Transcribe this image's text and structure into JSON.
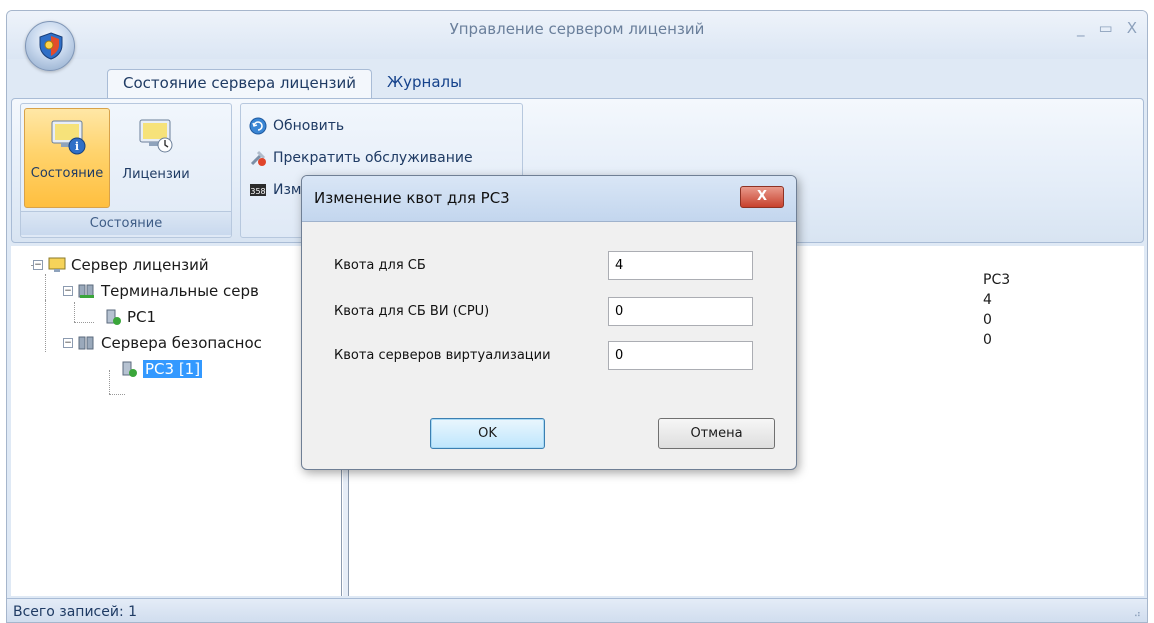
{
  "window": {
    "title": "Управление сервером лицензий",
    "controls": {
      "minimize": "_",
      "maximize": "▭",
      "close": "X"
    }
  },
  "tabs": [
    {
      "label": "Состояние сервера лицензий",
      "active": true
    },
    {
      "label": "Журналы",
      "active": false
    }
  ],
  "ribbon": {
    "group_state": {
      "label": "Состояние",
      "buttons": [
        {
          "label": "Состояние",
          "icon": "monitor-info-icon",
          "active": true
        },
        {
          "label": "Лицензии",
          "icon": "monitor-clock-icon",
          "active": false
        }
      ]
    },
    "group_actions": {
      "items": [
        {
          "label": "Обновить",
          "icon": "refresh-icon"
        },
        {
          "label": "Прекратить обслуживание",
          "icon": "stop-service-icon"
        },
        {
          "label": "Изм",
          "icon": "quota-icon"
        }
      ]
    }
  },
  "tree": {
    "root": "Сервер лицензий",
    "terminal_servers": "Терминальные серв",
    "pc1": "PC1",
    "security_servers": "Сервера безопаснос",
    "pc3": "PC3 [1]"
  },
  "details": {
    "values": [
      "PC3",
      "4",
      "0",
      "0"
    ]
  },
  "status": {
    "total": "Всего записей: 1",
    "grip": "⠴"
  },
  "dialog": {
    "title": "Изменение квот для  PC3",
    "close": "X",
    "fields": [
      {
        "label": "Квота для СБ",
        "value": "4"
      },
      {
        "label": "Квота для СБ ВИ (CPU)",
        "value": "0"
      },
      {
        "label": "Квота серверов виртуализации",
        "value": "0"
      }
    ],
    "ok": "OK",
    "cancel": "Отмена"
  },
  "colors": {
    "selection": "#3399ff",
    "active_ribbon_button": "#ffd36c",
    "dialog_close": "#c7412d"
  }
}
